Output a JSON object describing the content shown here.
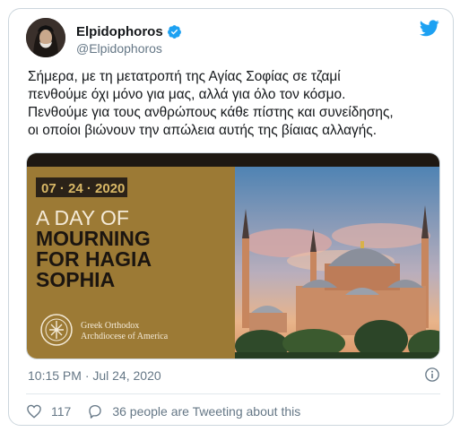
{
  "tweet": {
    "author_name": "Elpidophoros",
    "author_handle": "@Elpidophoros",
    "text": "Σήμερα, με τη μετατροπή της Αγίας Σοφίας σε τζαμί\nπενθούμε όχι μόνο για μας, αλλά για όλο τον κόσμο.\nΠενθούμε για τους ανθρώπους κάθε πίστης και συνείδησης,\nοι οποίοι βιώνουν την απώλεια αυτής της βίαιας αλλαγής.",
    "timestamp": "10:15 PM · Jul 24, 2020",
    "like_count": "117",
    "tweeting_about": "36 people are Tweeting about this"
  },
  "media": {
    "date": "07 · 24 · 2020",
    "headline_line1": "A DAY OF",
    "headline_line2": "MOURNING",
    "headline_line3": "FOR HAGIA",
    "headline_line4": "SOPHIA",
    "org_line1": "Greek Orthodox",
    "org_line2": "Archdiocese of America"
  },
  "colors": {
    "panel_gold": "#9c7a35",
    "date_box": "#2b2218",
    "twitter_blue": "#1da1f2",
    "secondary_text": "#657786"
  },
  "icons": [
    "verified-badge-icon",
    "twitter-bird-icon",
    "info-icon",
    "heart-icon",
    "comment-icon",
    "archdiocese-seal-icon"
  ]
}
